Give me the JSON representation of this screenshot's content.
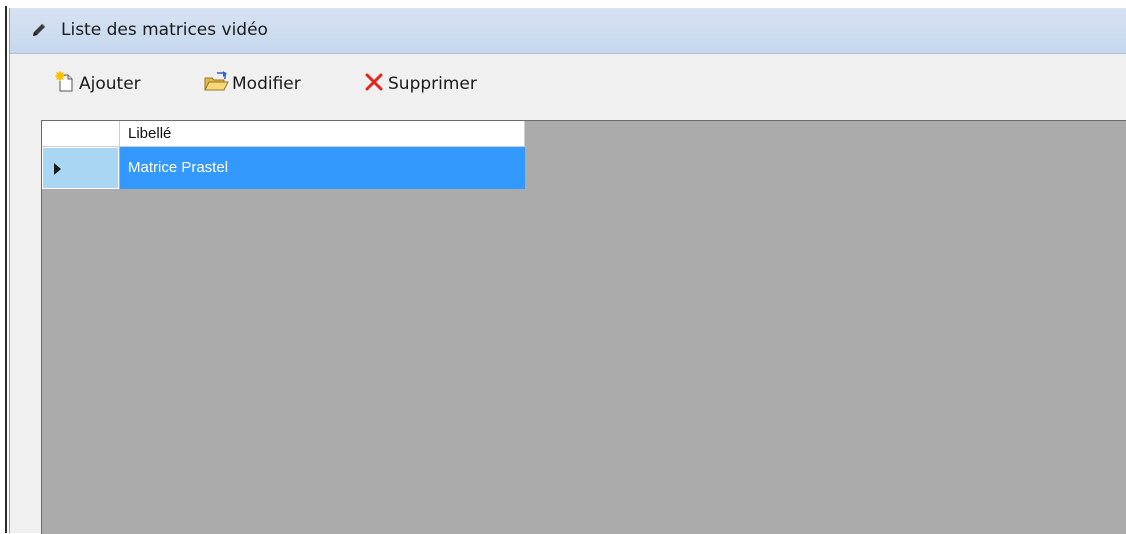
{
  "window": {
    "title": "Liste des matrices vidéo",
    "icon": "pencil-icon"
  },
  "toolbar": {
    "add_label": "Ajouter",
    "edit_label": "Modifier",
    "delete_label": "Supprimer",
    "add_icon": "new-document-icon",
    "edit_icon": "open-folder-icon",
    "delete_icon": "red-x-icon"
  },
  "grid": {
    "columns": [
      "Libellé"
    ],
    "rows": [
      {
        "libelle": "Matrice Prastel",
        "selected": true
      }
    ],
    "colors": {
      "selection": "#3399ff",
      "row_header_selected": "#a9d7f3",
      "background": "#ababab"
    }
  }
}
